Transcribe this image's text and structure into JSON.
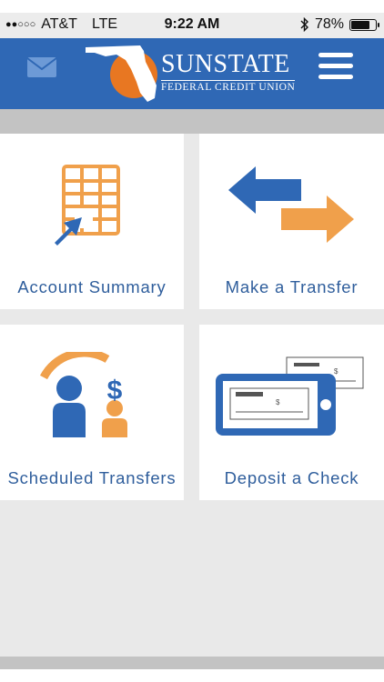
{
  "status_bar": {
    "carrier": "AT&T",
    "network": "LTE",
    "time": "9:22 AM",
    "battery": "78%",
    "battery_level": 0.78,
    "signal_icon": "signal-dots-icon",
    "bluetooth_icon": "bluetooth-icon"
  },
  "header": {
    "bg_color": "#2f68b5",
    "mail_icon": "mail-icon",
    "menu_icon": "hamburger-menu-icon",
    "logo": {
      "name": "SunState",
      "subtitle": "FEDERAL CREDIT UNION"
    }
  },
  "tiles": [
    {
      "label": "Account Summary",
      "icon": "account-summary-icon"
    },
    {
      "label": "Make a Transfer",
      "icon": "transfer-arrows-icon"
    },
    {
      "label": "Scheduled Transfers",
      "icon": "scheduled-transfers-icon"
    },
    {
      "label": "Deposit a Check",
      "icon": "deposit-check-icon"
    }
  ],
  "colors": {
    "brand_blue": "#2f68b5",
    "label_blue": "#2f5e9c",
    "accent_orange": "#f0a04b",
    "florida_orange": "#e87722"
  }
}
